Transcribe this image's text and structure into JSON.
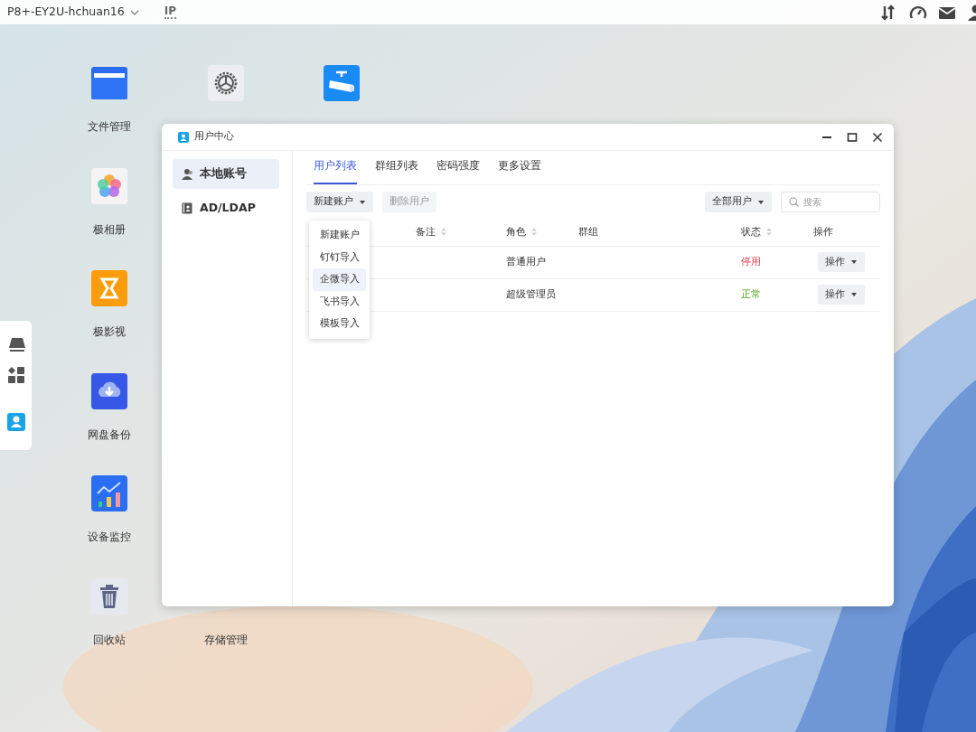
{
  "top_bar": {
    "device_name": "P8+-EY2U-hchuan16",
    "ip_label": "IP",
    "tray": [
      {
        "kind": "transfer"
      },
      {
        "kind": "gauge"
      },
      {
        "kind": "mail"
      },
      {
        "kind": "user"
      }
    ]
  },
  "desktop_icons": [
    {
      "kind": "folder",
      "label": "文件管理"
    },
    {
      "kind": "photos",
      "label": "极相册"
    },
    {
      "kind": "video",
      "label": "极影视"
    },
    {
      "kind": "cloud",
      "label": "网盘备份"
    },
    {
      "kind": "monitor",
      "label": "设备监控"
    },
    {
      "kind": "trash",
      "label": "回收站"
    },
    {
      "kind": "gear"
    },
    {
      "kind": "hidden",
      "label": "存储管理"
    },
    {
      "kind": "camera"
    }
  ],
  "dock": [
    {
      "kind": "drive",
      "selected": false
    },
    {
      "kind": "apps",
      "selected": false
    },
    {
      "kind": "user",
      "selected": true
    }
  ],
  "window": {
    "title": "用户中心",
    "sidebar": [
      {
        "kind": "user",
        "label": "本地账号",
        "selected": true
      },
      {
        "kind": "book",
        "label": "AD/LDAP",
        "selected": false
      }
    ],
    "tabs": [
      {
        "label": "用户列表",
        "selected": true
      },
      {
        "label": "群组列表",
        "selected": false
      },
      {
        "label": "密码强度",
        "selected": false
      },
      {
        "label": "更多设置",
        "selected": false
      }
    ],
    "toolbar": {
      "new_button": "新建账户",
      "delete_button": {
        "label": "删除用户",
        "disabled": true
      },
      "filter": "全部用户",
      "search": {
        "placeholder": "搜索"
      }
    },
    "table": {
      "columns": [
        {
          "label": "备注",
          "sortable": true
        },
        {
          "label": "角色",
          "sortable": true
        },
        {
          "label": "群组",
          "sortable": false
        },
        {
          "label": "状态",
          "sortable": true
        },
        {
          "label": "操作",
          "sortable": false
        }
      ],
      "rows": [
        {
          "role": "普通用户",
          "status": "停用",
          "kind": "stopped",
          "action": "操作"
        },
        {
          "role": "超级管理员",
          "status": "正常",
          "kind": "active",
          "action": "操作"
        }
      ]
    },
    "menu": [
      {
        "label": "新建账户",
        "selected": false
      },
      {
        "label": "钉钉导入",
        "selected": false
      },
      {
        "label": "企微导入",
        "selected": true
      },
      {
        "label": "飞书导入",
        "selected": false
      },
      {
        "label": "模板导入",
        "selected": false
      }
    ]
  }
}
